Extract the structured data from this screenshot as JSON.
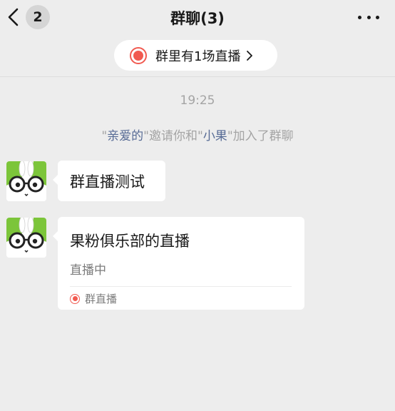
{
  "header": {
    "unread_count": "2",
    "title": "群聊(3)"
  },
  "live_banner": {
    "text": "群里有1场直播"
  },
  "chat": {
    "timestamp": "19:25",
    "system_message": {
      "q1": "\"",
      "inviter": "亲爱的",
      "mid": "\"邀请你和\"",
      "invitee": "小果",
      "end": "\"加入了群聊"
    },
    "messages": [
      {
        "text": "群直播测试"
      },
      {
        "card_title": "果粉俱乐部的直播",
        "card_status": "直播中",
        "card_source": "群直播"
      }
    ]
  },
  "colors": {
    "background": "#ededed",
    "bubble": "#ffffff",
    "live_red": "#f15a50",
    "link_blue": "#576b95",
    "avatar_green": "#7cc53a"
  },
  "icons": {
    "back": "back-chevron-icon",
    "more": "more-icon",
    "record": "record-icon",
    "chevron": "chevron-right-icon",
    "avatar": "bunny-avatar"
  }
}
